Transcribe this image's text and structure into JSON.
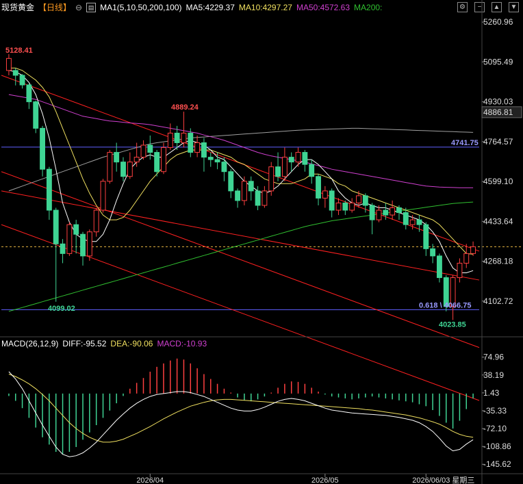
{
  "header": {
    "symbol": "现货黄金",
    "period": "【日线】",
    "period_icon": "toggle-icon",
    "ma_icon": "chart-icon",
    "ma_label": "MA1(5,10,50,200,100)",
    "ma5": "MA5:4229.37",
    "ma10": "MA10:4297.27",
    "ma50": "MA50:4572.63",
    "ma200": "MA200:",
    "toolbar_icons": [
      "settings-icon",
      "minus-icon",
      "up-icon",
      "down-icon"
    ]
  },
  "macd_header": {
    "label": "MACD(26,12,9)",
    "diff": "DIFF:-95.52",
    "dea": "DEA:-90.06",
    "macd": "MACD:-10.93"
  },
  "colors": {
    "up": "#ff4040",
    "down": "#3fd494",
    "ma5": "#ffffff",
    "ma10": "#f0e060",
    "ma50": "#d040d0",
    "ma200": "#30c030",
    "ma100": "#a0a0a0",
    "trend": "#ff2020",
    "hline": "#6060ff"
  },
  "chart_data": [
    {
      "type": "candlestick",
      "title": "现货黄金【日线】",
      "yaxis_ticks": [
        "5260.96",
        "5095.49",
        "4930.03",
        "4764.57",
        "4599.10",
        "4433.64",
        "4268.18",
        "4102.72"
      ],
      "ylim": [
        3960,
        5290
      ],
      "x_ticks": [
        "2026/04",
        "2026/05",
        "2026/06/03 星期三"
      ],
      "annotations": {
        "high_label": "5128.41",
        "mid_high_label": "4889.24",
        "low_label": "4099.02",
        "recent_low_label": "4023.85",
        "right_price_label": "4886.81",
        "hline_upper_label": "4741.75",
        "hline_lower_label": "0.618 \\ 4066.75"
      },
      "hline_upper": 4741.75,
      "hline_lower": 4066.75,
      "current_price": 4328,
      "candles": [
        [
          5060,
          5110,
          5040,
          5128
        ],
        [
          5060,
          5040,
          4998,
          5070
        ],
        [
          5040,
          5000,
          4985,
          5045
        ],
        [
          5000,
          4930,
          4900,
          5005
        ],
        [
          4930,
          4820,
          4800,
          4935
        ],
        [
          4820,
          4650,
          4620,
          4830
        ],
        [
          4650,
          4480,
          4440,
          4660
        ],
        [
          4480,
          4340,
          4100,
          4490
        ],
        [
          4340,
          4300,
          4260,
          4360
        ],
        [
          4300,
          4420,
          4290,
          4430
        ],
        [
          4420,
          4380,
          4300,
          4440
        ],
        [
          4380,
          4290,
          4250,
          4390
        ],
        [
          4290,
          4390,
          4270,
          4400
        ],
        [
          4390,
          4480,
          4370,
          4490
        ],
        [
          4480,
          4600,
          4470,
          4610
        ],
        [
          4600,
          4720,
          4590,
          4730
        ],
        [
          4720,
          4680,
          4640,
          4760
        ],
        [
          4680,
          4620,
          4600,
          4700
        ],
        [
          4620,
          4680,
          4610,
          4720
        ],
        [
          4680,
          4700,
          4660,
          4760
        ],
        [
          4700,
          4750,
          4690,
          4770
        ],
        [
          4750,
          4720,
          4690,
          4790
        ],
        [
          4720,
          4640,
          4620,
          4730
        ],
        [
          4640,
          4740,
          4630,
          4760
        ],
        [
          4740,
          4800,
          4730,
          4840
        ],
        [
          4800,
          4760,
          4730,
          4830
        ],
        [
          4760,
          4800,
          4740,
          4889
        ],
        [
          4800,
          4720,
          4700,
          4820
        ],
        [
          4720,
          4760,
          4700,
          4790
        ],
        [
          4760,
          4700,
          4640,
          4780
        ],
        [
          4700,
          4690,
          4660,
          4720
        ],
        [
          4690,
          4680,
          4650,
          4720
        ],
        [
          4680,
          4640,
          4600,
          4700
        ],
        [
          4640,
          4560,
          4530,
          4650
        ],
        [
          4560,
          4520,
          4490,
          4570
        ],
        [
          4520,
          4600,
          4500,
          4620
        ],
        [
          4600,
          4560,
          4520,
          4620
        ],
        [
          4560,
          4500,
          4480,
          4580
        ],
        [
          4500,
          4560,
          4490,
          4580
        ],
        [
          4560,
          4660,
          4540,
          4680
        ],
        [
          4660,
          4620,
          4600,
          4720
        ],
        [
          4620,
          4700,
          4600,
          4740
        ],
        [
          4700,
          4680,
          4640,
          4720
        ],
        [
          4680,
          4720,
          4660,
          4740
        ],
        [
          4720,
          4670,
          4640,
          4730
        ],
        [
          4670,
          4620,
          4590,
          4690
        ],
        [
          4620,
          4530,
          4500,
          4630
        ],
        [
          4530,
          4560,
          4490,
          4580
        ],
        [
          4560,
          4480,
          4450,
          4570
        ],
        [
          4480,
          4510,
          4460,
          4530
        ],
        [
          4510,
          4480,
          4460,
          4520
        ],
        [
          4480,
          4510,
          4470,
          4530
        ],
        [
          4510,
          4540,
          4490,
          4560
        ],
        [
          4540,
          4500,
          4470,
          4550
        ],
        [
          4500,
          4440,
          4380,
          4510
        ],
        [
          4440,
          4480,
          4430,
          4500
        ],
        [
          4480,
          4460,
          4440,
          4510
        ],
        [
          4460,
          4490,
          4440,
          4520
        ],
        [
          4490,
          4470,
          4440,
          4500
        ],
        [
          4470,
          4420,
          4400,
          4490
        ],
        [
          4420,
          4440,
          4400,
          4460
        ],
        [
          4440,
          4420,
          4390,
          4460
        ],
        [
          4420,
          4320,
          4290,
          4430
        ],
        [
          4320,
          4290,
          4260,
          4340
        ],
        [
          4290,
          4200,
          4180,
          4300
        ],
        [
          4200,
          4080,
          4060,
          4210
        ],
        [
          4080,
          4200,
          4024,
          4210
        ],
        [
          4200,
          4260,
          4180,
          4280
        ],
        [
          4260,
          4300,
          4240,
          4340
        ],
        [
          4300,
          4328,
          4290,
          4350
        ]
      ],
      "ma5": [
        5060,
        5055,
        5040,
        5010,
        4960,
        4880,
        4780,
        4650,
        4510,
        4430,
        4380,
        4360,
        4350,
        4350,
        4380,
        4440,
        4520,
        4590,
        4650,
        4680,
        4700,
        4710,
        4700,
        4700,
        4720,
        4740,
        4760,
        4770,
        4760,
        4750,
        4730,
        4700,
        4690,
        4660,
        4630,
        4600,
        4580,
        4560,
        4550,
        4560,
        4580,
        4610,
        4640,
        4670,
        4690,
        4690,
        4670,
        4640,
        4610,
        4560,
        4530,
        4510,
        4500,
        4510,
        4500,
        4490,
        4490,
        4480,
        4470,
        4460,
        4450,
        4440,
        4420,
        4390,
        4350,
        4290,
        4240,
        4220,
        4220,
        4229
      ],
      "ma10": [
        5070,
        5070,
        5060,
        5040,
        5020,
        4990,
        4950,
        4890,
        4820,
        4750,
        4680,
        4610,
        4550,
        4500,
        4460,
        4440,
        4440,
        4450,
        4480,
        4520,
        4560,
        4600,
        4630,
        4660,
        4690,
        4710,
        4720,
        4730,
        4730,
        4730,
        4730,
        4720,
        4710,
        4700,
        4680,
        4670,
        4650,
        4630,
        4610,
        4600,
        4590,
        4590,
        4590,
        4600,
        4610,
        4630,
        4630,
        4620,
        4610,
        4590,
        4580,
        4560,
        4550,
        4540,
        4530,
        4520,
        4510,
        4500,
        4490,
        4480,
        4470,
        4460,
        4450,
        4440,
        4420,
        4390,
        4360,
        4330,
        4300,
        4297
      ],
      "ma50": [
        4960,
        4955,
        4950,
        4945,
        4940,
        4930,
        4920,
        4910,
        4900,
        4890,
        4880,
        4870,
        4865,
        4860,
        4855,
        4850,
        4848,
        4845,
        4842,
        4840,
        4838,
        4835,
        4830,
        4825,
        4820,
        4815,
        4810,
        4805,
        4800,
        4792,
        4785,
        4778,
        4770,
        4760,
        4750,
        4740,
        4730,
        4720,
        4712,
        4705,
        4700,
        4695,
        4690,
        4685,
        4680,
        4672,
        4665,
        4658,
        4650,
        4645,
        4640,
        4635,
        4630,
        4625,
        4620,
        4615,
        4610,
        4605,
        4600,
        4595,
        4590,
        4585,
        4580,
        4578,
        4576,
        4575,
        4574,
        4573,
        4573,
        4573
      ],
      "ma200": [
        4060,
        4068,
        4076,
        4084,
        4092,
        4100,
        4108,
        4116,
        4124,
        4132,
        4140,
        4148,
        4156,
        4164,
        4172,
        4180,
        4188,
        4196,
        4204,
        4212,
        4220,
        4228,
        4236,
        4244,
        4252,
        4260,
        4268,
        4276,
        4284,
        4292,
        4300,
        4308,
        4316,
        4324,
        4332,
        4340,
        4348,
        4356,
        4364,
        4372,
        4380,
        4388,
        4396,
        4404,
        4412,
        4418,
        4424,
        4430,
        4436,
        4440,
        4444,
        4448,
        4452,
        4456,
        4460,
        4464,
        4468,
        4472,
        4476,
        4480,
        4484,
        4488,
        4492,
        4496,
        4500,
        4504,
        4508,
        4510,
        4512,
        4514
      ],
      "ma100": [
        4560,
        4570,
        4580,
        4590,
        4600,
        4610,
        4620,
        4630,
        4640,
        4650,
        4660,
        4670,
        4680,
        4690,
        4700,
        4708,
        4716,
        4724,
        4732,
        4740,
        4748,
        4755,
        4760,
        4764,
        4768,
        4772,
        4776,
        4780,
        4782,
        4784,
        4786,
        4788,
        4790,
        4792,
        4794,
        4796,
        4798,
        4800,
        4802,
        4804,
        4806,
        4808,
        4810,
        4812,
        4813,
        4814,
        4815,
        4816,
        4817,
        4818,
        4819,
        4820,
        4820,
        4819,
        4818,
        4817,
        4816,
        4815,
        4814,
        4813,
        4812,
        4811,
        4810,
        4809,
        4808,
        4807,
        4806,
        4805,
        4804,
        4803
      ]
    },
    {
      "type": "macd",
      "title": "MACD(26,12,9)",
      "yaxis_ticks": [
        "74.96",
        "38.19",
        "1.43",
        "-35.33",
        "-72.10",
        "-108.86",
        "-145.62"
      ],
      "ylim": [
        -165,
        90
      ],
      "hist": [
        -5,
        -15,
        -30,
        -50,
        -70,
        -90,
        -105,
        -120,
        -125,
        -120,
        -110,
        -95,
        -80,
        -65,
        -50,
        -35,
        -20,
        -5,
        10,
        22,
        32,
        45,
        55,
        62,
        68,
        72,
        70,
        62,
        52,
        40,
        30,
        20,
        10,
        2,
        -8,
        -14,
        -16,
        -12,
        -6,
        2,
        12,
        20,
        25,
        24,
        20,
        12,
        4,
        -2,
        -6,
        -8,
        -10,
        -12,
        -10,
        -8,
        -6,
        -8,
        -10,
        -12,
        -14,
        -16,
        -18,
        -22,
        -26,
        -34,
        -46,
        -60,
        -72,
        -56,
        -32,
        -10
      ],
      "diff": [
        45,
        30,
        10,
        -15,
        -40,
        -65,
        -88,
        -110,
        -125,
        -130,
        -128,
        -122,
        -112,
        -100,
        -85,
        -70,
        -55,
        -42,
        -30,
        -20,
        -12,
        -6,
        -2,
        0,
        2,
        4,
        4,
        2,
        -2,
        -6,
        -12,
        -18,
        -24,
        -30,
        -34,
        -36,
        -36,
        -33,
        -28,
        -22,
        -16,
        -12,
        -10,
        -12,
        -15,
        -20,
        -25,
        -30,
        -34,
        -36,
        -38,
        -40,
        -41,
        -42,
        -43,
        -44,
        -45,
        -47,
        -49,
        -52,
        -55,
        -60,
        -68,
        -78,
        -92,
        -108,
        -118,
        -115,
        -104,
        -95
      ],
      "dea": [
        40,
        35,
        28,
        20,
        10,
        -2,
        -15,
        -30,
        -45,
        -60,
        -72,
        -82,
        -90,
        -96,
        -100,
        -100,
        -98,
        -94,
        -88,
        -82,
        -75,
        -68,
        -60,
        -52,
        -45,
        -38,
        -32,
        -26,
        -22,
        -18,
        -15,
        -13,
        -12,
        -12,
        -13,
        -14,
        -15,
        -16,
        -17,
        -18,
        -19,
        -20,
        -21,
        -22,
        -23,
        -24,
        -25,
        -26,
        -27,
        -28,
        -29,
        -30,
        -31,
        -33,
        -34,
        -36,
        -38,
        -40,
        -42,
        -44,
        -47,
        -50,
        -54,
        -58,
        -63,
        -70,
        -78,
        -84,
        -88,
        -90
      ]
    }
  ]
}
